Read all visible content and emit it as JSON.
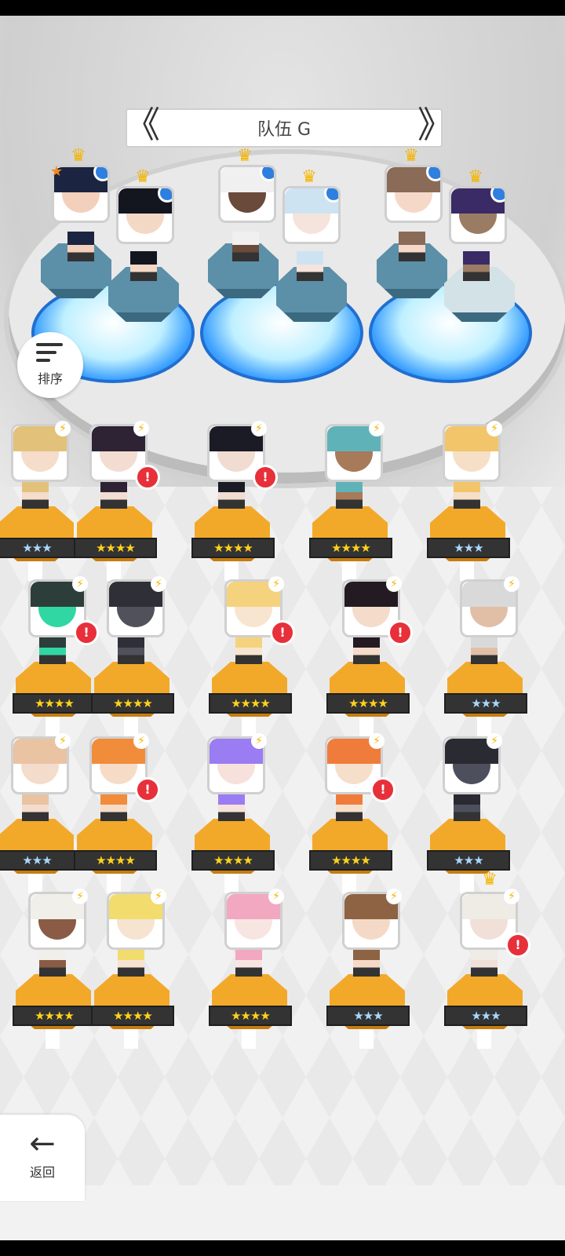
{
  "team": {
    "name": "队伍 G",
    "prev_arrow": "《",
    "next_arrow": "》"
  },
  "sort": {
    "label": "排序"
  },
  "back": {
    "label": "返回"
  },
  "team_slots": [
    {
      "hair": "#1b2440",
      "skin": "#f3d0bb",
      "leader": true
    },
    {
      "hair": "#14161f",
      "skin": "#f4d8c6",
      "leader": false
    },
    {
      "hair": "#f0f0f0",
      "skin": "#6a4a3b",
      "leader": false
    },
    {
      "hair": "#cde3f2",
      "skin": "#f5e4dc",
      "leader": false
    },
    {
      "hair": "#8a6b58",
      "skin": "#f6d8c9",
      "leader": false
    },
    {
      "hair": "#3a2b66",
      "skin": "#9a7c64",
      "leader": false
    }
  ],
  "heroes": [
    {
      "stars": "★★★",
      "hair": "#e2c27a",
      "skin": "#f5dccb",
      "alert": false,
      "crown": false
    },
    {
      "stars": "★★★★",
      "hair": "#2e2235",
      "skin": "#f3ddd2",
      "alert": true,
      "crown": false
    },
    {
      "stars": "★★★★",
      "hair": "#1b1b25",
      "skin": "#f1dcd2",
      "alert": true,
      "crown": false
    },
    {
      "stars": "★★★★",
      "hair": "#5fb3b8",
      "skin": "#a77a5a",
      "alert": false,
      "crown": false
    },
    {
      "stars": "★★★",
      "hair": "#f2c56b",
      "skin": "#f5e0c7",
      "alert": false,
      "crown": false
    },
    {
      "stars": "★★★★",
      "hair": "#2d3d3a",
      "skin": "#31d7a2",
      "alert": true,
      "crown": false
    },
    {
      "stars": "★★★★",
      "hair": "#2f2f37",
      "skin": "#51515b",
      "alert": false,
      "crown": false
    },
    {
      "stars": "★★★★",
      "hair": "#f5d27d",
      "skin": "#f8e5d0",
      "alert": true,
      "crown": false
    },
    {
      "stars": "★★★★",
      "hair": "#231b21",
      "skin": "#f4dbca",
      "alert": true,
      "crown": false
    },
    {
      "stars": "★★★",
      "hair": "#d9d9d9",
      "skin": "#e1bfa7",
      "alert": false,
      "crown": false
    },
    {
      "stars": "★★★",
      "hair": "#e9c3a2",
      "skin": "#f4dccd",
      "alert": false,
      "crown": false
    },
    {
      "stars": "★★★★",
      "hair": "#f08c3a",
      "skin": "#f6dcc6",
      "alert": true,
      "crown": false
    },
    {
      "stars": "★★★★",
      "hair": "#9a7df2",
      "skin": "#f7e1dc",
      "alert": false,
      "crown": false
    },
    {
      "stars": "★★★★",
      "hair": "#f07c3c",
      "skin": "#f6dfca",
      "alert": true,
      "crown": false
    },
    {
      "stars": "★★★",
      "hair": "#2a2a33",
      "skin": "#4e4f5d",
      "alert": false,
      "crown": false
    },
    {
      "stars": "★★★★",
      "hair": "#f1efe9",
      "skin": "#8a5c46",
      "alert": false,
      "crown": false
    },
    {
      "stars": "★★★★",
      "hair": "#f2dc6e",
      "skin": "#f6e3d0",
      "alert": false,
      "crown": false
    },
    {
      "stars": "★★★★",
      "hair": "#f3a8c2",
      "skin": "#f8e5e2",
      "alert": false,
      "crown": false
    },
    {
      "stars": "★★★",
      "hair": "#8e6343",
      "skin": "#f4dac6",
      "alert": false,
      "crown": false
    },
    {
      "stars": "★★★",
      "hair": "#efece5",
      "skin": "#f1e0d8",
      "alert": true,
      "crown": true
    }
  ]
}
